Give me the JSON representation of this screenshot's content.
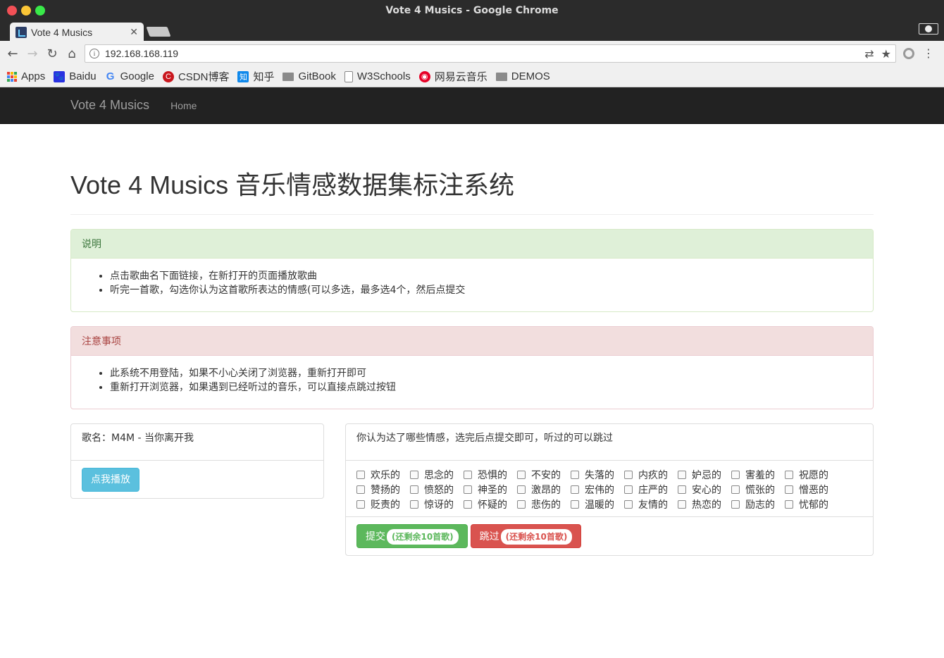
{
  "window": {
    "title": "Vote 4 Musics - Google Chrome"
  },
  "tab": {
    "title": "Vote 4 Musics"
  },
  "address": {
    "url": "192.168.168.119"
  },
  "bookmarks": [
    {
      "label": "Apps",
      "icon": "apps-icon"
    },
    {
      "label": "Baidu",
      "icon": "baidu-icon"
    },
    {
      "label": "Google",
      "icon": "google-icon"
    },
    {
      "label": "CSDN博客",
      "icon": "csdn-icon"
    },
    {
      "label": "知乎",
      "icon": "zhihu-icon"
    },
    {
      "label": "GitBook",
      "icon": "folder-icon"
    },
    {
      "label": "W3Schools",
      "icon": "page-icon"
    },
    {
      "label": "网易云音乐",
      "icon": "netease-music-icon"
    },
    {
      "label": "DEMOS",
      "icon": "folder-icon"
    }
  ],
  "navbar": {
    "brand": "Vote 4 Musics",
    "home": "Home"
  },
  "page_title": "Vote 4 Musics 音乐情感数据集标注系统",
  "instructions": {
    "heading": "说明",
    "items": [
      "点击歌曲名下面链接，在新打开的页面播放歌曲",
      "听完一首歌，勾选你认为这首歌所表达的情感(可以多选，最多选4个，然后点提交"
    ]
  },
  "notes": {
    "heading": "注意事项",
    "items": [
      "此系统不用登陆，如果不小心关闭了浏览器，重新打开即可",
      "重新打开浏览器，如果遇到已经听过的音乐，可以直接点跳过按钮"
    ]
  },
  "song": {
    "label": "歌名：M4M - 当你离开我",
    "play_button": "点我播放"
  },
  "emotion_panel": {
    "prompt": "你认为达了哪些情感，选完后点提交即可，听过的可以跳过",
    "emotions": [
      "欢乐的",
      "思念的",
      "恐惧的",
      "不安的",
      "失落的",
      "内疚的",
      "妒忌的",
      "害羞的",
      "祝愿的",
      "赞扬的",
      "愤怒的",
      "神圣的",
      "激昂的",
      "宏伟的",
      "庄严的",
      "安心的",
      "慌张的",
      "憎恶的",
      "贬责的",
      "惊讶的",
      "怀疑的",
      "悲伤的",
      "温暖的",
      "友情的",
      "热恋的",
      "励志的",
      "忧郁的"
    ],
    "submit": {
      "label": "提交",
      "badge": "(还剩余10首歌)"
    },
    "skip": {
      "label": "跳过",
      "badge": "(还剩余10首歌)"
    }
  }
}
